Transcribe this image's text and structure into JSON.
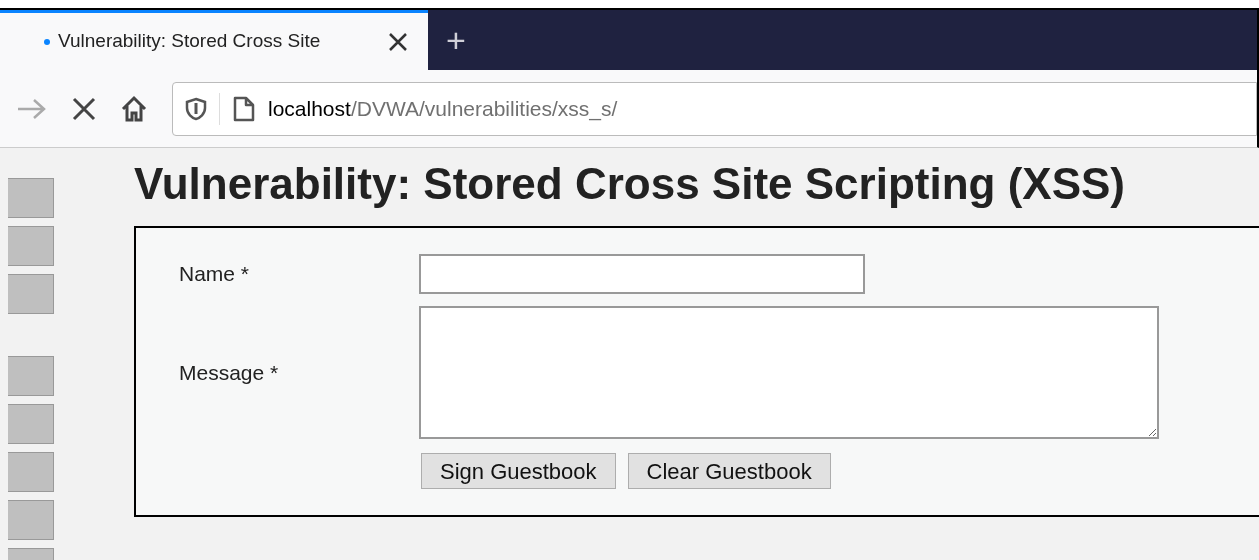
{
  "browser": {
    "tab": {
      "title": "Vulnerability: Stored Cross Site",
      "loading": true,
      "selected": true
    },
    "new_tab": "+",
    "url": {
      "host": "localhost",
      "path": "/DVWA/vulnerabilities/xss_s/"
    }
  },
  "page": {
    "heading": "Vulnerability: Stored Cross Site Scripting (XSS)",
    "form": {
      "name_label": "Name *",
      "message_label": "Message *",
      "buttons": [
        {
          "label": "Sign Guestbook"
        },
        {
          "label": "Clear Guestbook"
        }
      ]
    }
  }
}
